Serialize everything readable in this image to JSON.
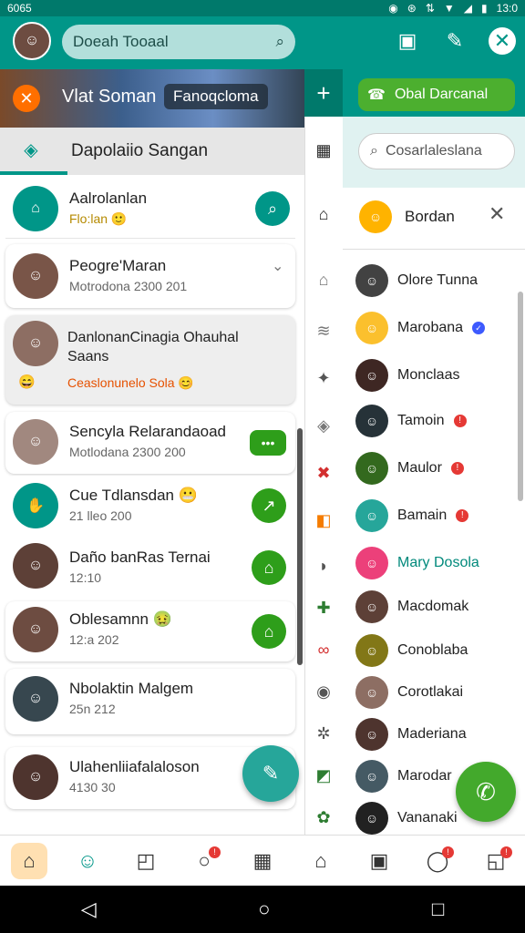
{
  "status": {
    "time": "6065",
    "right_time": "13:0"
  },
  "top": {
    "search_placeholder": "Doeah Tooaal"
  },
  "banner": {
    "title": "Vlat Soman",
    "tag": "Fanoqcloma"
  },
  "section": {
    "title": "Dapolaiio Sangan"
  },
  "cards": [
    {
      "name": "Aalrolanlan",
      "sub": "Flo:lan 🙂",
      "color": "#009688"
    },
    {
      "name": "Peogre'Maran",
      "sub": "Motrodona 2300 201",
      "color": "#795548"
    },
    {
      "name": "DanlonanCinagia Ohauhal Saans",
      "sub": "Ceaslonunelo Sola 😊",
      "color": "#8d6e63"
    },
    {
      "name": "Sencyla Relarandaoad",
      "sub": "Motlodana 2300 200",
      "color": "#a1887f"
    },
    {
      "name": "Cue Tdlansdan 😬",
      "sub": "21 lleo 200",
      "color": "#009688"
    },
    {
      "name": "Daño banRas Ternai",
      "sub": "12:10",
      "color": "#5d4037"
    },
    {
      "name": "Oblesamnn 🤢",
      "sub": "12:a 202",
      "color": "#6d4c41"
    },
    {
      "name": "Nbolaktin Malgem",
      "sub": "25n 212",
      "color": "#37474f"
    },
    {
      "name": "Ulahenliiafalaloson",
      "sub": "4130 30",
      "color": "#4e342e"
    }
  ],
  "card_action_dots": "•••",
  "right": {
    "button": "Obal Darcanal",
    "search": "Cosarlaleslana",
    "user": "Bordan",
    "contacts": [
      {
        "name": "Olore Tunna",
        "badge": ""
      },
      {
        "name": "Marobana",
        "badge": "blue"
      },
      {
        "name": "Monclaas",
        "badge": ""
      },
      {
        "name": "Tamoin",
        "badge": "red"
      },
      {
        "name": "Maulor",
        "badge": "red"
      },
      {
        "name": "Bamain",
        "badge": "red"
      },
      {
        "name": "Mary Dosola",
        "badge": ""
      },
      {
        "name": "Macdomak",
        "badge": ""
      },
      {
        "name": "Conoblaba",
        "badge": ""
      },
      {
        "name": "Corotlakai",
        "badge": ""
      },
      {
        "name": "Maderiana",
        "badge": ""
      },
      {
        "name": "Marodar",
        "badge": ""
      },
      {
        "name": "Vananaki",
        "badge": ""
      }
    ]
  }
}
